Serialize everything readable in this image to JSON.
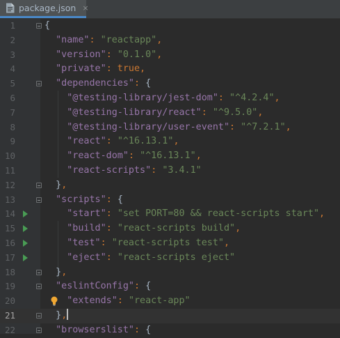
{
  "tab": {
    "filename": "package.json",
    "close": "×",
    "icon": "json-file-icon"
  },
  "lines": [
    {
      "n": "1",
      "html": "<span class=\"p\">{</span>"
    },
    {
      "n": "2",
      "html": "  <span class=\"k\">\"name\"</span><span class=\"b\">: </span><span class=\"s\">\"reactapp\"</span><span class=\"b\">,</span>"
    },
    {
      "n": "3",
      "html": "  <span class=\"k\">\"version\"</span><span class=\"b\">: </span><span class=\"s\">\"0.1.0\"</span><span class=\"b\">,</span>"
    },
    {
      "n": "4",
      "html": "  <span class=\"k\">\"private\"</span><span class=\"b\">: true,</span>"
    },
    {
      "n": "5",
      "html": "  <span class=\"k\">\"dependencies\"</span><span class=\"b\">: </span><span class=\"p\">{</span>"
    },
    {
      "n": "6",
      "html": "    <span class=\"k\">\"@testing-library/jest-dom\"</span><span class=\"b\">: </span><span class=\"s\">\"^4.2.4\"</span><span class=\"b\">,</span>"
    },
    {
      "n": "7",
      "html": "    <span class=\"k\">\"@testing-library/react\"</span><span class=\"b\">: </span><span class=\"s\">\"^9.5.0\"</span><span class=\"b\">,</span>"
    },
    {
      "n": "8",
      "html": "    <span class=\"k\">\"@testing-library/user-event\"</span><span class=\"b\">: </span><span class=\"s\">\"^7.2.1\"</span><span class=\"b\">,</span>"
    },
    {
      "n": "9",
      "html": "    <span class=\"k\">\"react\"</span><span class=\"b\">: </span><span class=\"s\">\"^16.13.1\"</span><span class=\"b\">,</span>"
    },
    {
      "n": "10",
      "html": "    <span class=\"k\">\"react-dom\"</span><span class=\"b\">: </span><span class=\"s\">\"^16.13.1\"</span><span class=\"b\">,</span>"
    },
    {
      "n": "11",
      "html": "    <span class=\"k\">\"react-scripts\"</span><span class=\"b\">: </span><span class=\"s\">\"3.4.1\"</span>"
    },
    {
      "n": "12",
      "html": "  <span class=\"p\">}</span><span class=\"b\">,</span>"
    },
    {
      "n": "13",
      "html": "  <span class=\"k\">\"scripts\"</span><span class=\"b\">: </span><span class=\"p\">{</span>"
    },
    {
      "n": "14",
      "html": "    <span class=\"k\">\"start\"</span><span class=\"b\">: </span><span class=\"s\">\"set PORT=80 &amp;&amp; react-scripts start\"</span><span class=\"b\">,</span>"
    },
    {
      "n": "15",
      "html": "    <span class=\"k\">\"build\"</span><span class=\"b\">: </span><span class=\"s\">\"react-scripts build\"</span><span class=\"b\">,</span>"
    },
    {
      "n": "16",
      "html": "    <span class=\"k\">\"test\"</span><span class=\"b\">: </span><span class=\"s\">\"react-scripts test\"</span><span class=\"b\">,</span>"
    },
    {
      "n": "17",
      "html": "    <span class=\"k\">\"eject\"</span><span class=\"b\">: </span><span class=\"s\">\"react-scripts eject\"</span>"
    },
    {
      "n": "18",
      "html": "  <span class=\"p\">}</span><span class=\"b\">,</span>"
    },
    {
      "n": "19",
      "html": "  <span class=\"k\">\"eslintConfig\"</span><span class=\"b\">: </span><span class=\"p\">{</span>"
    },
    {
      "n": "20",
      "html": "    <span class=\"k\">\"extends\"</span><span class=\"b\">: </span><span class=\"s\">\"react-app\"</span>"
    },
    {
      "n": "21",
      "html": "  <span class=\"p\">}</span><span class=\"b\">,</span>"
    },
    {
      "n": "22",
      "html": "  <span class=\"k\">\"browserslist\"</span><span class=\"b\">: </span><span class=\"p\">{</span>"
    }
  ],
  "current_line": "21",
  "run_lines": [
    "14",
    "15",
    "16",
    "17"
  ],
  "fold_open_lines": [
    "1",
    "5",
    "13",
    "19",
    "22"
  ],
  "fold_close_lines": [
    "12",
    "18",
    "21"
  ],
  "intention_bulb_line": "20",
  "colors": {
    "key": "#9876aa",
    "string": "#6a8759",
    "keyword": "#cc7832",
    "background": "#2b2b2b"
  }
}
